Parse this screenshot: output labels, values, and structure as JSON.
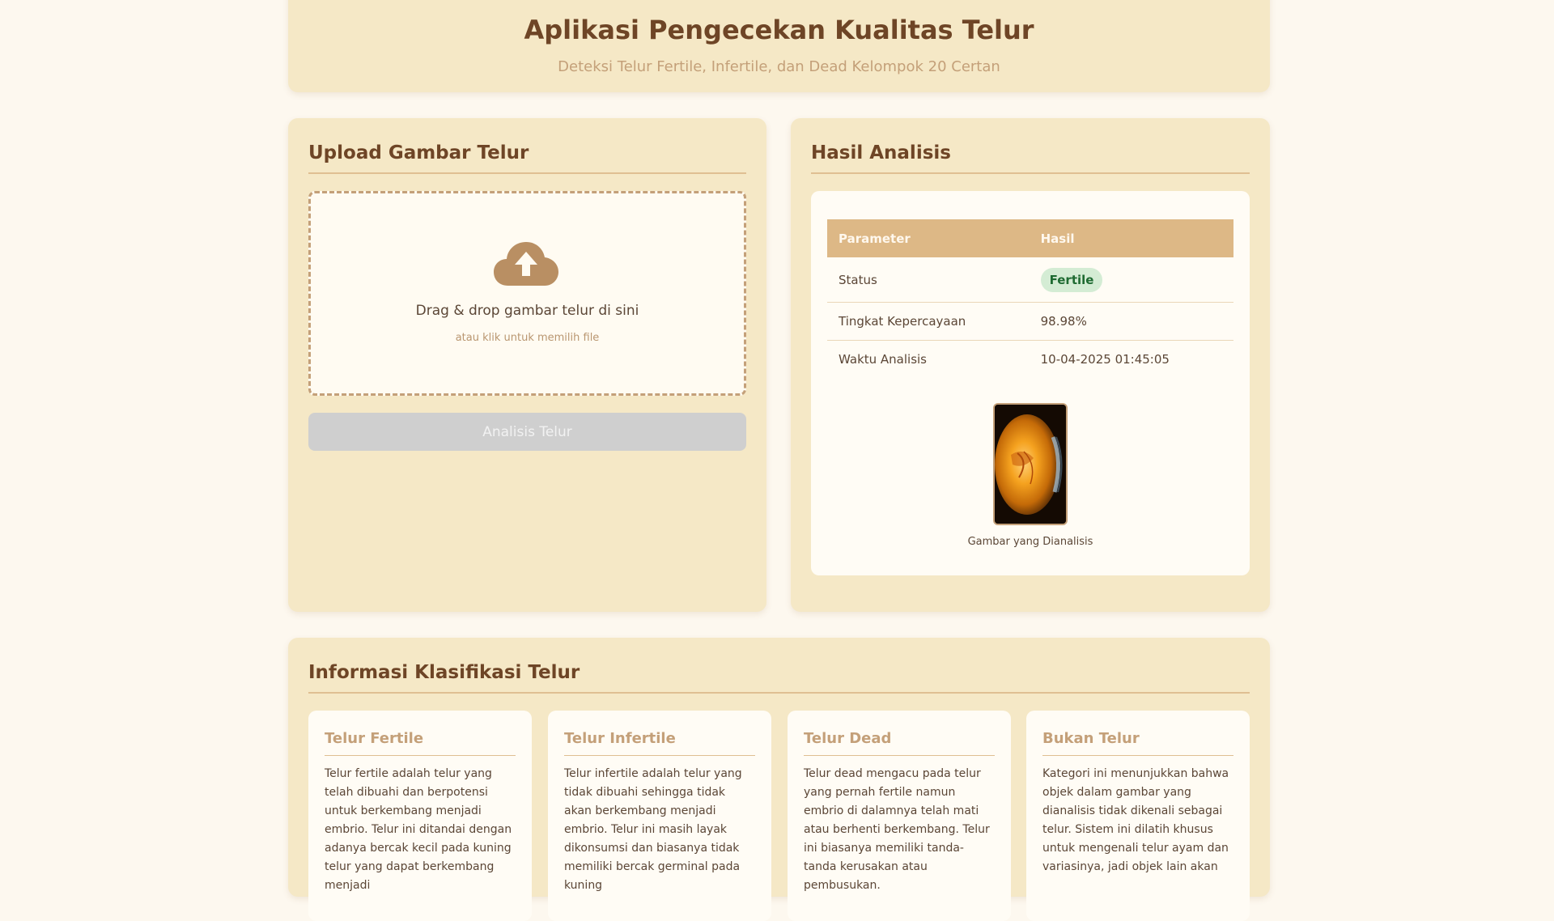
{
  "header": {
    "title": "Aplikasi Pengecekan Kualitas Telur",
    "subtitle": "Deteksi Telur Fertile, Infertile, dan Dead Kelompok 20 Certan"
  },
  "upload": {
    "title": "Upload Gambar Telur",
    "icon": "cloud-upload-icon",
    "drop_main": "Drag & drop gambar telur di sini",
    "drop_sub": "atau klik untuk memilih file",
    "button_label": "Analisis Telur"
  },
  "result": {
    "title": "Hasil Analisis",
    "table": {
      "headers": [
        "Parameter",
        "Hasil"
      ],
      "rows": [
        {
          "param": "Status",
          "value": "Fertile"
        },
        {
          "param": "Tingkat Kepercayaan",
          "value": "98.98%"
        },
        {
          "param": "Waktu Analisis",
          "value": "10-04-2025 01:45:05"
        }
      ]
    },
    "image_caption": "Gambar yang Dianalisis"
  },
  "info": {
    "title": "Informasi Klasifikasi Telur",
    "cards": [
      {
        "title": "Telur Fertile",
        "text": "Telur fertile adalah telur yang telah dibuahi dan berpotensi untuk berkembang menjadi embrio. Telur ini ditandai dengan adanya bercak kecil pada kuning telur yang dapat berkembang menjadi"
      },
      {
        "title": "Telur Infertile",
        "text": "Telur infertile adalah telur yang tidak dibuahi sehingga tidak akan berkembang menjadi embrio. Telur ini masih layak dikonsumsi dan biasanya tidak memiliki bercak germinal pada kuning"
      },
      {
        "title": "Telur Dead",
        "text": "Telur dead mengacu pada telur yang pernah fertile namun embrio di dalamnya telah mati atau berhenti berkembang. Telur ini biasanya memiliki tanda-tanda kerusakan atau pembusukan."
      },
      {
        "title": "Bukan Telur",
        "text": "Kategori ini menunjukkan bahwa objek dalam gambar yang dianalisis tidak dikenali sebagai telur. Sistem ini dilatih khusus untuk mengenali telur ayam dan variasinya, jadi objek lain akan"
      }
    ]
  },
  "colors": {
    "background": "#fdf8ef",
    "panel": "#f5e8c6",
    "accent": "#ddb886",
    "title": "#6e4526",
    "badge_bg": "#d4ecd4",
    "badge_text": "#1f6b32"
  }
}
